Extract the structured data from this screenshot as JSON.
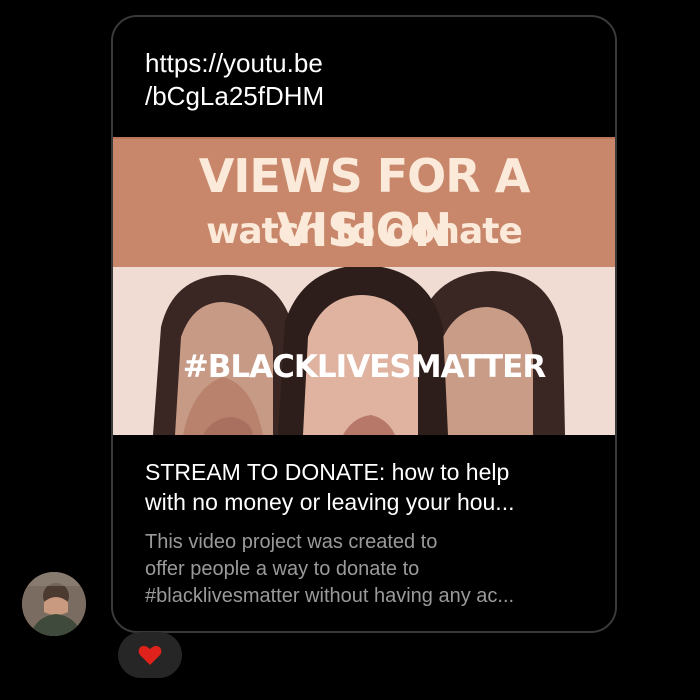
{
  "message": {
    "url_lines": [
      "https://youtu.be",
      "/bCgLa25fDHM"
    ],
    "preview": {
      "banner_title": "VIEWS FOR A VISION",
      "banner_subtitle": "watch to donate",
      "hashtag": "#BLACKLIVESMATTER",
      "title_lines": [
        "STREAM TO DONATE: how to help",
        "with no money or leaving your hou..."
      ],
      "description_lines": [
        "This video project was created to",
        "offer people a way to donate to",
        "#blacklivesmatter without having any ac..."
      ]
    },
    "reaction": {
      "icon": "heart-icon",
      "color": "#e0221c"
    }
  },
  "colors": {
    "background": "#000000",
    "bubble_border": "#3a3a3a",
    "banner": "#c8876a",
    "banner_text": "#fbe9d9",
    "secondary_text": "#9a9a9a"
  }
}
